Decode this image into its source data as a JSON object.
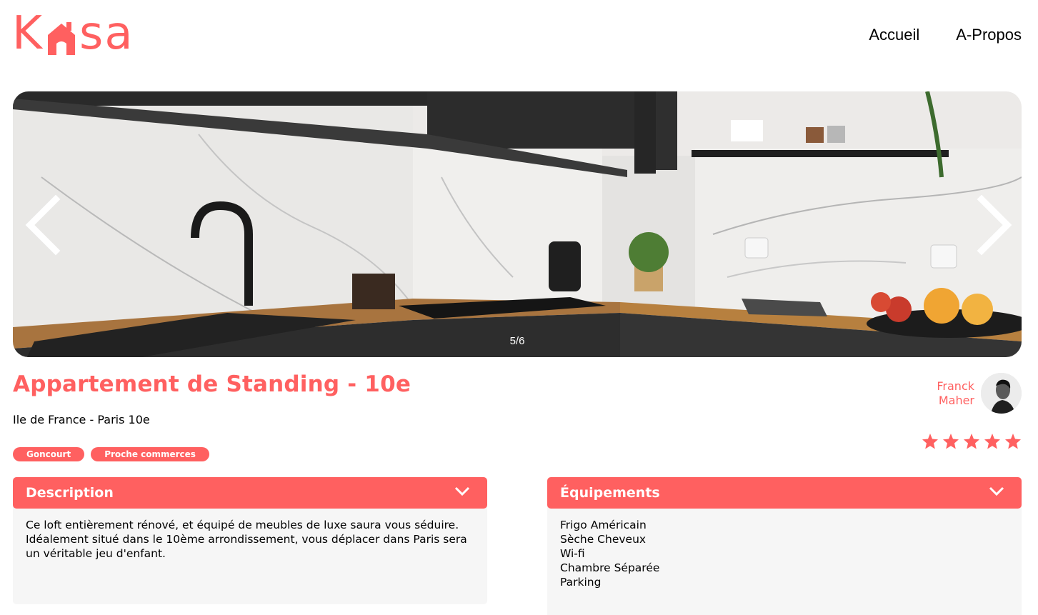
{
  "header": {
    "logo_text_left": "K",
    "logo_text_right": "sa",
    "nav": [
      {
        "label": "Accueil"
      },
      {
        "label": "A-Propos"
      }
    ]
  },
  "carousel": {
    "counter": "5/6",
    "icons": {
      "prev": "chevron-left-icon",
      "next": "chevron-right-icon"
    }
  },
  "listing": {
    "title": "Appartement de Standing - 10e",
    "location": "Ile de France - Paris 10e",
    "tags": [
      "Goncourt",
      "Proche commerces"
    ],
    "host": {
      "first_name": "Franck",
      "last_name": "Maher"
    },
    "rating": 5,
    "rating_max": 5
  },
  "description": {
    "title": "Description",
    "text": "Ce loft entièrement rénové, et équipé de meubles de luxe saura vous séduire. Idéalement situé dans le 10ème arrondissement, vous déplacer dans Paris sera un véritable jeu d'enfant."
  },
  "equipments": {
    "title": "Équipements",
    "items": [
      "Frigo Américain",
      "Sèche Cheveux",
      "Wi-fi",
      "Chambre Séparée",
      "Parking"
    ]
  },
  "colors": {
    "brand": "#FF6060",
    "panel_bg": "#F6F6F6",
    "star_inactive": "#E3E3E3"
  }
}
